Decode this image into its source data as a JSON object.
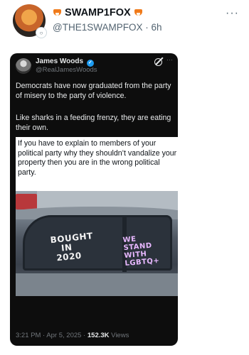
{
  "post": {
    "display_name": "SWAMP1FOX",
    "handle": "@THE1SWAMPFOX",
    "time": "6h",
    "more": "···"
  },
  "embedded": {
    "author_name": "James Woods",
    "author_handle": "@RealJamesWoods",
    "more": "···",
    "paragraph1": "Democrats have now graduated from the party of misery to the party of violence.",
    "paragraph2": "Like sharks in a feeding frenzy, they are eating their own.",
    "quote_text": "If you have to explain to members of your political party why they shouldn’t vandalize your property then you are in the wrong political party.",
    "car_text_left": [
      "BOUGHT",
      "IN",
      "2020"
    ],
    "car_text_right": [
      "WE",
      "STAND",
      "WITH",
      "LGBTQ+"
    ],
    "meta_time": "3:21 PM · Apr 5, 2025 ·",
    "meta_views_count": "152.3K",
    "meta_views_label": "Views"
  }
}
